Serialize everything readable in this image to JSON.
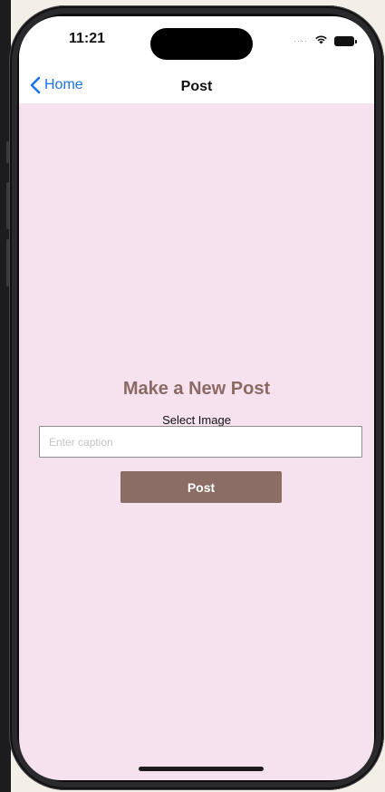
{
  "status_bar": {
    "time": "11:21",
    "icons": [
      "cellular-dots-icon",
      "wifi-icon",
      "battery-icon"
    ]
  },
  "nav": {
    "back_label": "Home",
    "back_icon": "chevron-left-icon",
    "title": "Post"
  },
  "main": {
    "heading": "Make a New Post",
    "select_image_label": "Select Image",
    "caption_placeholder": "Enter caption",
    "caption_value": "",
    "post_button_label": "Post"
  },
  "colors": {
    "screen_background": "#f6e1ef",
    "heading": "#8a6b64",
    "button": "#8b6d66",
    "back_link": "#1a73e8"
  }
}
